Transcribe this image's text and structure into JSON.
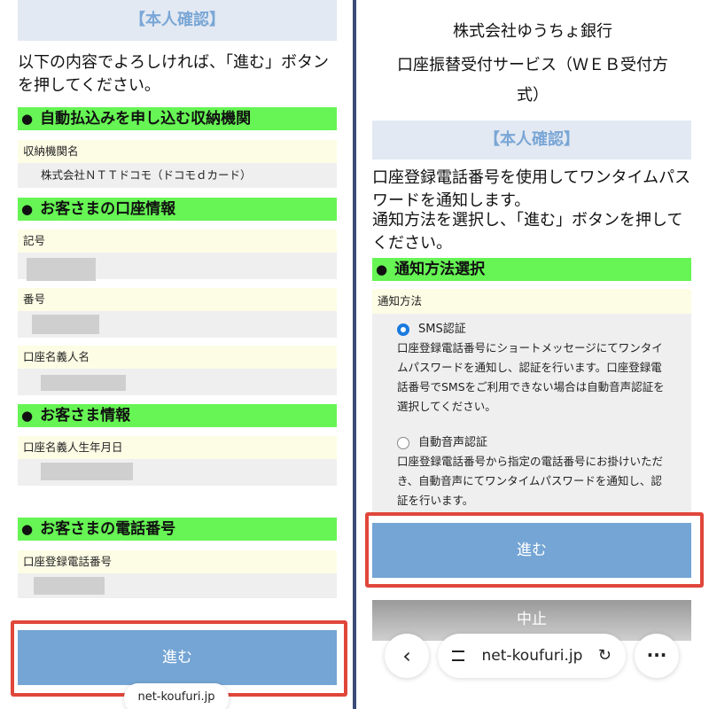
{
  "left": {
    "header": "【本人確認】",
    "intro": "以下の内容でよろしければ、「進む」ボタンを押してください。",
    "sections": {
      "institution": {
        "title": "自動払込みを申し込む収納機関",
        "label": "収納機関名",
        "value": "株式会社ＮＴＴドコモ（ドコモｄカード）"
      },
      "account": {
        "title": "お客さまの口座情報",
        "fields": [
          "記号",
          "番号",
          "口座名義人名"
        ]
      },
      "customer": {
        "title": "お客さま情報",
        "fields": [
          "口座名義人生年月日"
        ]
      },
      "phone": {
        "title": "お客さまの電話番号",
        "fields": [
          "口座登録電話番号"
        ]
      }
    },
    "proceed_button": "進む",
    "url": "net-koufuri.jp"
  },
  "right": {
    "title_line1": "株式会社ゆうちょ銀行",
    "title_line2": "口座振替受付サービス（ＷＥＢ受付方",
    "title_line3": "式）",
    "header": "【本人確認】",
    "intro_1": "口座登録電話番号を使用してワンタイムパスワードを通知します。",
    "intro_2": "通知方法を選択し、「進む」ボタンを押してください。",
    "section_title": "通知方法選択",
    "method_label": "通知方法",
    "options": [
      {
        "label": "SMS認証",
        "selected": true,
        "description": "口座登録電話番号にショートメッセージにてワンタイムパスワードを通知し、認証を行います。口座登録電話番号でSMSをご利用できない場合は自動音声認証を選択してください。"
      },
      {
        "label": "自動音声認証",
        "selected": false,
        "description": "口座登録電話番号から指定の電話番号にお掛けいただき、自動音声にてワンタイムパスワードを通知し、認証を行います。"
      }
    ],
    "proceed_button": "進む",
    "cancel_button": "中止",
    "url": "net-koufuri.jp"
  },
  "colors": {
    "section_green": "#66f554",
    "button_blue": "#74a5d4",
    "highlight_red": "#e0463a",
    "radio_blue": "#1a7ae0"
  }
}
